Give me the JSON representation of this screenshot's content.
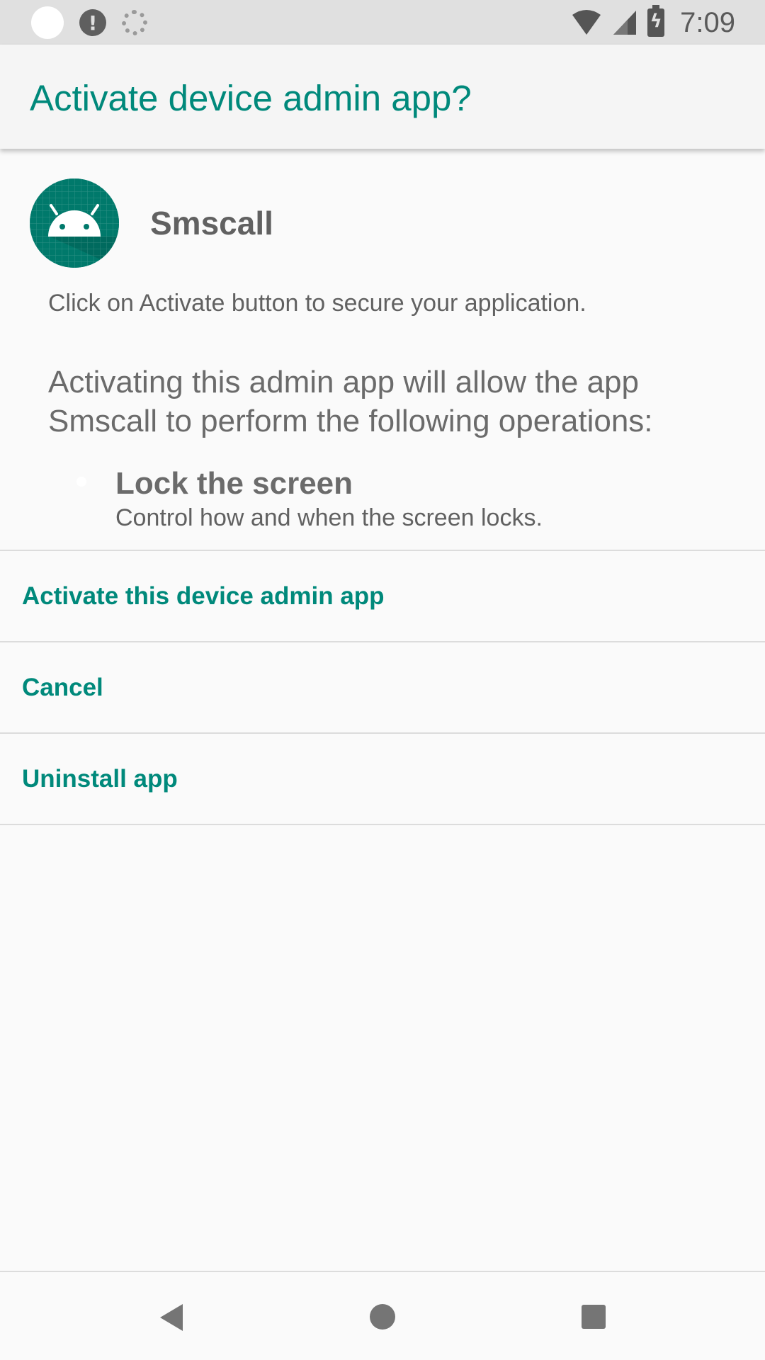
{
  "status_bar": {
    "time": "7:09",
    "icons": [
      "notification-dot-icon",
      "alert-icon",
      "sync-icon",
      "wifi-icon",
      "signal-icon",
      "battery-charging-icon"
    ],
    "alert_glyph": "!",
    "battery_glyph": "ϟ"
  },
  "header": {
    "title": "Activate device admin app?"
  },
  "app": {
    "icon": "android-icon",
    "name": "Smscall",
    "description": "Click on Activate button to secure your application."
  },
  "intro_text": "Activating this admin app will allow the app Smscall to perform the following operations:",
  "policies": [
    {
      "title": "Lock the screen",
      "description": "Control how and when the screen locks."
    }
  ],
  "actions": {
    "activate": "Activate this device admin app",
    "cancel": "Cancel",
    "uninstall": "Uninstall app"
  },
  "nav_bar": {
    "icons": [
      "back-icon",
      "home-icon",
      "recents-icon"
    ]
  },
  "colors": {
    "accent": "#00897b",
    "app_icon_bg": "#00796b",
    "background": "#fafafa"
  }
}
